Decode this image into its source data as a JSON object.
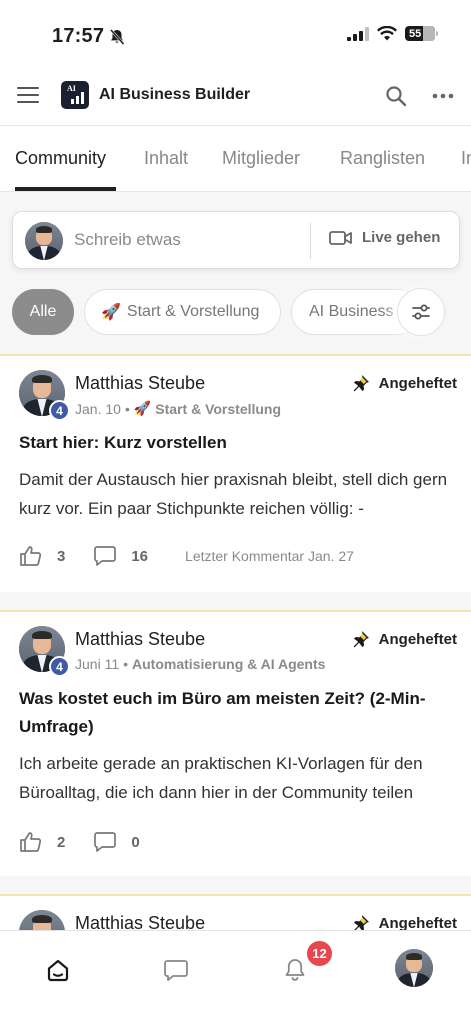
{
  "status_bar": {
    "time": "17:57",
    "battery": "55"
  },
  "header": {
    "title": "AI Business Builder",
    "logo_text": "AI"
  },
  "tabs": [
    {
      "label": "Community",
      "active": true
    },
    {
      "label": "Inhalt"
    },
    {
      "label": "Mitglieder"
    },
    {
      "label": "Ranglisten"
    },
    {
      "label": "In"
    }
  ],
  "composer": {
    "placeholder": "Schreib etwas",
    "live_label": "Live gehen"
  },
  "filters": [
    {
      "label": "Alle",
      "active": true
    },
    {
      "label": "Start & Vorstellung",
      "emoji": "🚀"
    },
    {
      "label": "AI Business"
    }
  ],
  "posts": [
    {
      "author": "Matthias Steube",
      "level": "4",
      "date": "Jan. 10",
      "category_emoji": "🚀",
      "category": "Start & Vorstellung",
      "pinned_label": "Angeheftet",
      "title": "Start hier: Kurz vorstellen",
      "excerpt": "Damit der Austausch hier praxisnah bleibt, stell dich gern kurz vor. Ein paar Stichpunkte reichen völlig: -",
      "likes": "3",
      "comments": "16",
      "last_comment": "Letzter Kommentar Jan. 27"
    },
    {
      "author": "Matthias Steube",
      "level": "4",
      "date": "Juni 11",
      "category": "Automatisierung & AI Agents",
      "pinned_label": "Angeheftet",
      "title": "Was kostet euch im Büro am meisten Zeit? (2-Min-Umfrage)",
      "excerpt": "Ich arbeite gerade an praktischen KI-Vorlagen für den Büroalltag, die ich dann hier in der Community teilen",
      "likes": "2",
      "comments": "0"
    },
    {
      "author": "Matthias Steube",
      "pinned_label": "Angeheftet"
    }
  ],
  "bottom_nav": {
    "notifications_count": "12"
  },
  "colors": {
    "accent": "#3f5aa6",
    "pinned_border": "#f6e3b0",
    "badge": "#e5484d",
    "chip_active": "#8c8c8c"
  }
}
